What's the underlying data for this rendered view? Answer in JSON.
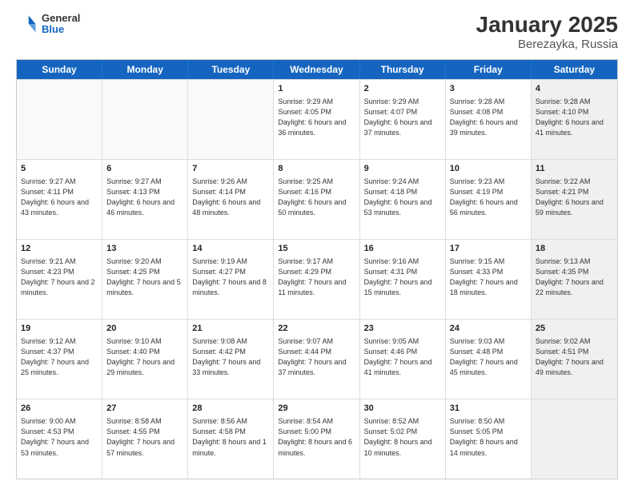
{
  "logo": {
    "general": "General",
    "blue": "Blue"
  },
  "title": "January 2025",
  "subtitle": "Berezayka, Russia",
  "header_days": [
    "Sunday",
    "Monday",
    "Tuesday",
    "Wednesday",
    "Thursday",
    "Friday",
    "Saturday"
  ],
  "weeks": [
    [
      {
        "day": "",
        "text": "",
        "empty": true
      },
      {
        "day": "",
        "text": "",
        "empty": true
      },
      {
        "day": "",
        "text": "",
        "empty": true
      },
      {
        "day": "1",
        "text": "Sunrise: 9:29 AM\nSunset: 4:05 PM\nDaylight: 6 hours and 36 minutes."
      },
      {
        "day": "2",
        "text": "Sunrise: 9:29 AM\nSunset: 4:07 PM\nDaylight: 6 hours and 37 minutes."
      },
      {
        "day": "3",
        "text": "Sunrise: 9:28 AM\nSunset: 4:08 PM\nDaylight: 6 hours and 39 minutes."
      },
      {
        "day": "4",
        "text": "Sunrise: 9:28 AM\nSunset: 4:10 PM\nDaylight: 6 hours and 41 minutes.",
        "shaded": true
      }
    ],
    [
      {
        "day": "5",
        "text": "Sunrise: 9:27 AM\nSunset: 4:11 PM\nDaylight: 6 hours and 43 minutes."
      },
      {
        "day": "6",
        "text": "Sunrise: 9:27 AM\nSunset: 4:13 PM\nDaylight: 6 hours and 46 minutes."
      },
      {
        "day": "7",
        "text": "Sunrise: 9:26 AM\nSunset: 4:14 PM\nDaylight: 6 hours and 48 minutes."
      },
      {
        "day": "8",
        "text": "Sunrise: 9:25 AM\nSunset: 4:16 PM\nDaylight: 6 hours and 50 minutes."
      },
      {
        "day": "9",
        "text": "Sunrise: 9:24 AM\nSunset: 4:18 PM\nDaylight: 6 hours and 53 minutes."
      },
      {
        "day": "10",
        "text": "Sunrise: 9:23 AM\nSunset: 4:19 PM\nDaylight: 6 hours and 56 minutes."
      },
      {
        "day": "11",
        "text": "Sunrise: 9:22 AM\nSunset: 4:21 PM\nDaylight: 6 hours and 59 minutes.",
        "shaded": true
      }
    ],
    [
      {
        "day": "12",
        "text": "Sunrise: 9:21 AM\nSunset: 4:23 PM\nDaylight: 7 hours and 2 minutes."
      },
      {
        "day": "13",
        "text": "Sunrise: 9:20 AM\nSunset: 4:25 PM\nDaylight: 7 hours and 5 minutes."
      },
      {
        "day": "14",
        "text": "Sunrise: 9:19 AM\nSunset: 4:27 PM\nDaylight: 7 hours and 8 minutes."
      },
      {
        "day": "15",
        "text": "Sunrise: 9:17 AM\nSunset: 4:29 PM\nDaylight: 7 hours and 11 minutes."
      },
      {
        "day": "16",
        "text": "Sunrise: 9:16 AM\nSunset: 4:31 PM\nDaylight: 7 hours and 15 minutes."
      },
      {
        "day": "17",
        "text": "Sunrise: 9:15 AM\nSunset: 4:33 PM\nDaylight: 7 hours and 18 minutes."
      },
      {
        "day": "18",
        "text": "Sunrise: 9:13 AM\nSunset: 4:35 PM\nDaylight: 7 hours and 22 minutes.",
        "shaded": true
      }
    ],
    [
      {
        "day": "19",
        "text": "Sunrise: 9:12 AM\nSunset: 4:37 PM\nDaylight: 7 hours and 25 minutes."
      },
      {
        "day": "20",
        "text": "Sunrise: 9:10 AM\nSunset: 4:40 PM\nDaylight: 7 hours and 29 minutes."
      },
      {
        "day": "21",
        "text": "Sunrise: 9:08 AM\nSunset: 4:42 PM\nDaylight: 7 hours and 33 minutes."
      },
      {
        "day": "22",
        "text": "Sunrise: 9:07 AM\nSunset: 4:44 PM\nDaylight: 7 hours and 37 minutes."
      },
      {
        "day": "23",
        "text": "Sunrise: 9:05 AM\nSunset: 4:46 PM\nDaylight: 7 hours and 41 minutes."
      },
      {
        "day": "24",
        "text": "Sunrise: 9:03 AM\nSunset: 4:48 PM\nDaylight: 7 hours and 45 minutes."
      },
      {
        "day": "25",
        "text": "Sunrise: 9:02 AM\nSunset: 4:51 PM\nDaylight: 7 hours and 49 minutes.",
        "shaded": true
      }
    ],
    [
      {
        "day": "26",
        "text": "Sunrise: 9:00 AM\nSunset: 4:53 PM\nDaylight: 7 hours and 53 minutes."
      },
      {
        "day": "27",
        "text": "Sunrise: 8:58 AM\nSunset: 4:55 PM\nDaylight: 7 hours and 57 minutes."
      },
      {
        "day": "28",
        "text": "Sunrise: 8:56 AM\nSunset: 4:58 PM\nDaylight: 8 hours and 1 minute."
      },
      {
        "day": "29",
        "text": "Sunrise: 8:54 AM\nSunset: 5:00 PM\nDaylight: 8 hours and 6 minutes."
      },
      {
        "day": "30",
        "text": "Sunrise: 8:52 AM\nSunset: 5:02 PM\nDaylight: 8 hours and 10 minutes."
      },
      {
        "day": "31",
        "text": "Sunrise: 8:50 AM\nSunset: 5:05 PM\nDaylight: 8 hours and 14 minutes."
      },
      {
        "day": "",
        "text": "",
        "empty": true,
        "shaded": true
      }
    ]
  ]
}
